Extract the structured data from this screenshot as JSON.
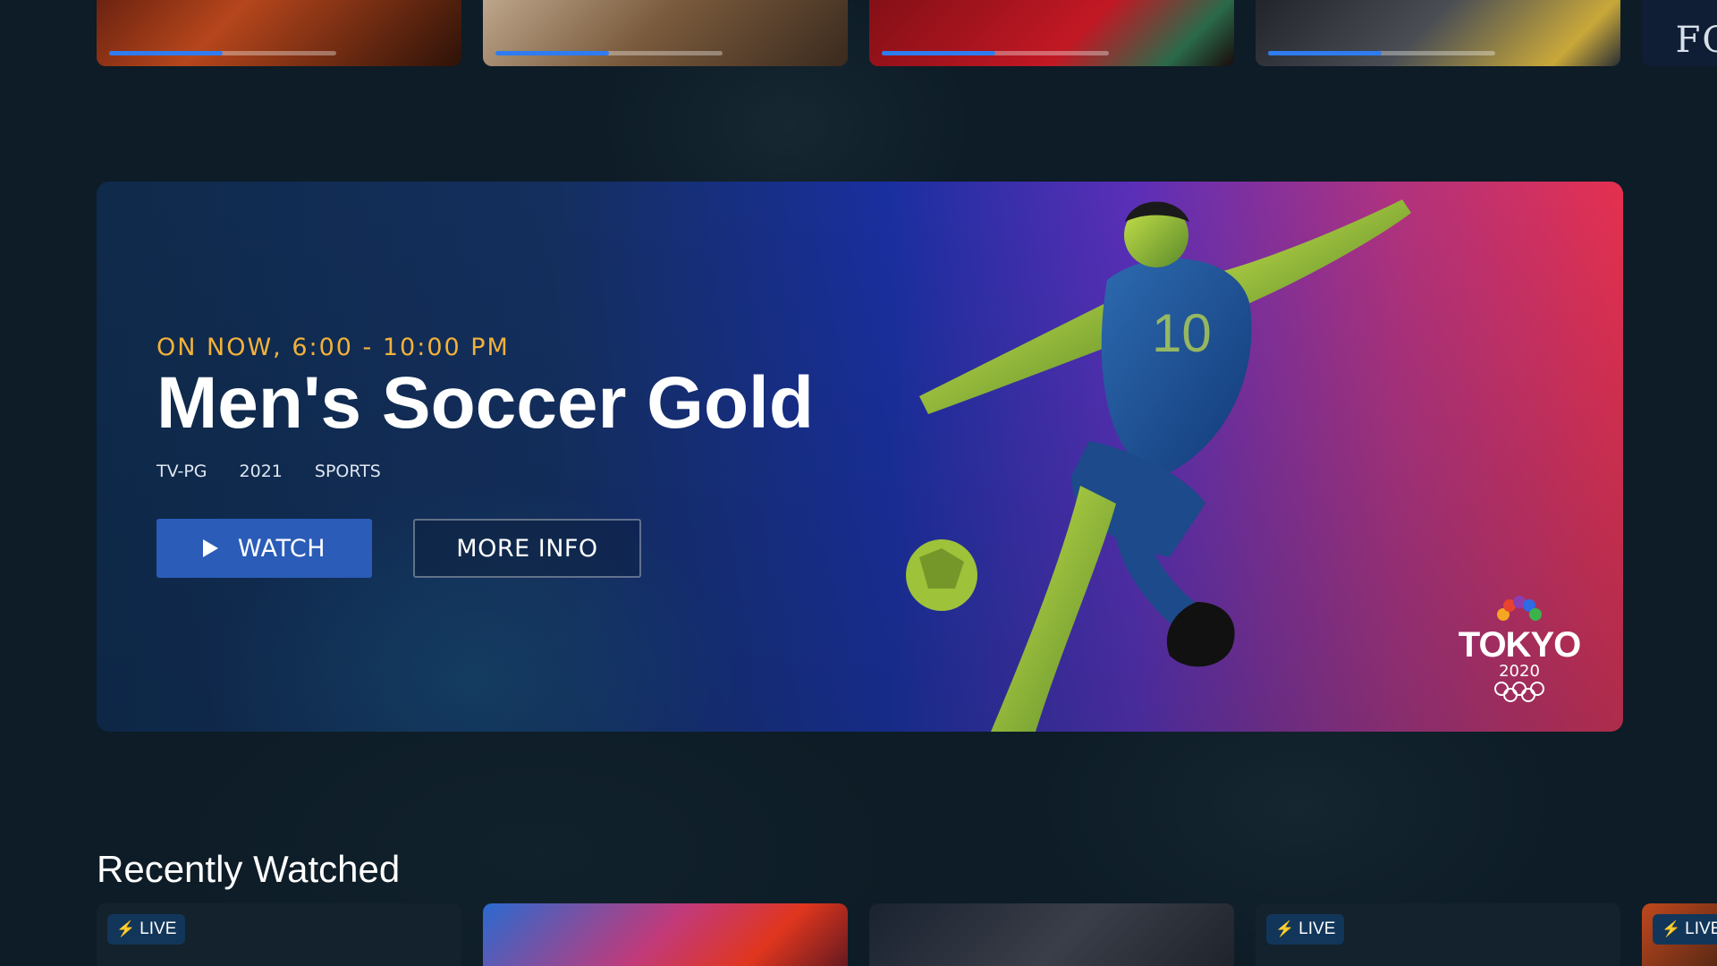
{
  "top_row": {
    "cards": [
      {
        "name": "continue-card-1",
        "progress": 0.5
      },
      {
        "name": "continue-card-2",
        "progress": 0.5
      },
      {
        "name": "continue-card-3",
        "progress": 0.5
      },
      {
        "name": "continue-card-4",
        "progress": 0.5
      },
      {
        "name": "continue-card-5",
        "partial_text": "FOI"
      }
    ]
  },
  "hero": {
    "eyebrow": "ON NOW, 6:00 - 10:00 PM",
    "title": "Men's Soccer Gold",
    "meta": {
      "rating": "TV-PG",
      "year": "2021",
      "genre": "SPORTS"
    },
    "watch_label": "WATCH",
    "more_info_label": "MORE INFO",
    "logo": {
      "word": "TOKYO",
      "year": "2020"
    }
  },
  "recently_watched": {
    "title": "Recently Watched",
    "live_label": "LIVE"
  },
  "colors": {
    "background": "#0d1c26",
    "accent": "#2a5cb8",
    "progress": "#2f7cf0",
    "eyebrow": "#f2b23a"
  }
}
